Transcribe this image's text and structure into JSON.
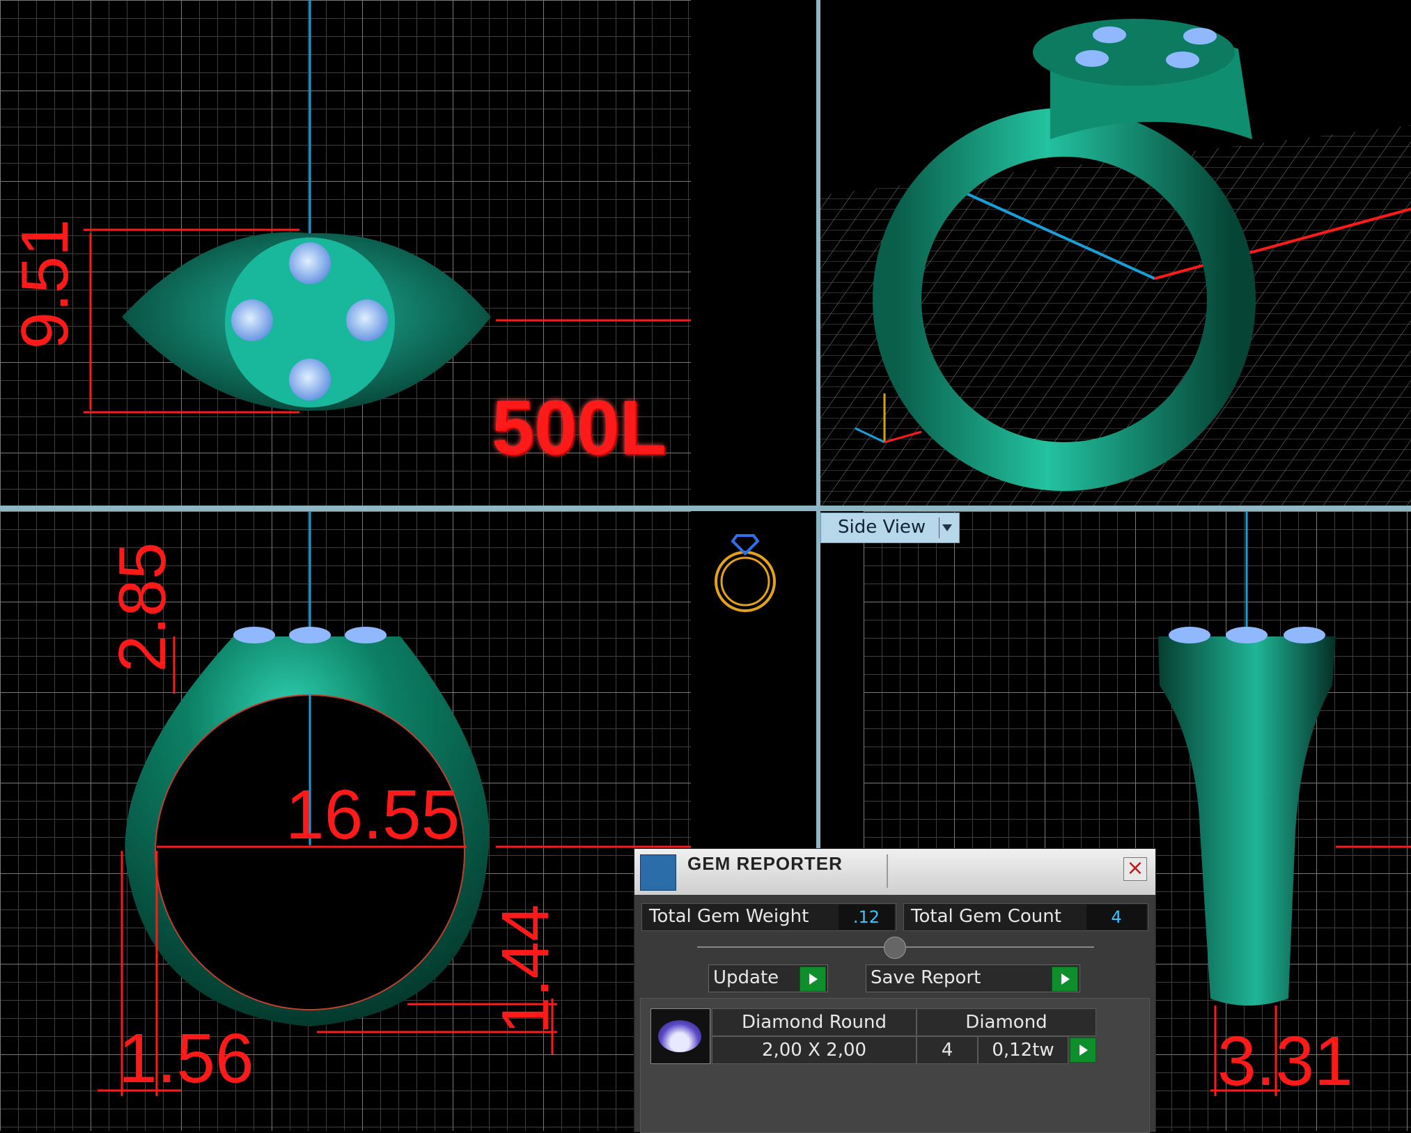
{
  "dimensions": {
    "top_height": "9.51",
    "watermark": "500L",
    "top_shank": "2.85",
    "inner_diameter": "16.55",
    "bottom_thickness": "1.44",
    "side_thickness": "1.56",
    "profile_width": "3.31"
  },
  "view_selector": {
    "label": "Side View"
  },
  "gem_reporter": {
    "title": "GEM REPORTER",
    "weight_label": "Total Gem Weight",
    "weight_value": ".12",
    "count_label": "Total Gem Count",
    "count_value": "4",
    "update_label": "Update",
    "save_label": "Save Report",
    "gem": {
      "name": "Diamond Round",
      "size": "2,00 X 2,00",
      "material": "Diamond",
      "count": "4",
      "weight": "0,12tw"
    }
  },
  "colors": {
    "metal": "#0a8c6a",
    "gem": "#8fb8ff",
    "dimension": "#ff1a1a",
    "axis_blue": "#1aa0d8"
  }
}
